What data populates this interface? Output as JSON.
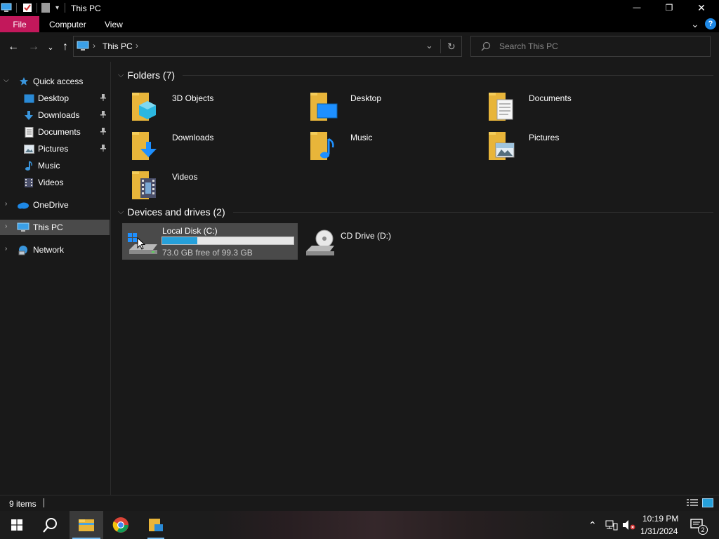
{
  "window": {
    "title": "This PC",
    "minimize_glyph": "—",
    "restore_glyph": "❐",
    "close_glyph": "✕"
  },
  "ribbon": {
    "tabs": [
      {
        "label": "File"
      },
      {
        "label": "Computer"
      },
      {
        "label": "View"
      }
    ],
    "help_glyph": "?",
    "expand_glyph": "⌄"
  },
  "nav": {
    "back_glyph": "←",
    "forward_glyph": "→",
    "recent_glyph": "⌄",
    "up_glyph": "↑",
    "address_crumb": "This PC",
    "address_sep": "›",
    "dropdown_glyph": "⌄",
    "refresh_glyph": "↻",
    "search_placeholder": "Search This PC"
  },
  "sidebar": {
    "quick_access": "Quick access",
    "items": [
      {
        "label": "Desktop",
        "icon": "desktop-icon",
        "pinned": true
      },
      {
        "label": "Downloads",
        "icon": "downloads-icon",
        "pinned": true
      },
      {
        "label": "Documents",
        "icon": "documents-icon",
        "pinned": true
      },
      {
        "label": "Pictures",
        "icon": "pictures-icon",
        "pinned": true
      },
      {
        "label": "Music",
        "icon": "music-icon",
        "pinned": false
      },
      {
        "label": "Videos",
        "icon": "videos-icon",
        "pinned": false
      }
    ],
    "onedrive": "OneDrive",
    "this_pc": "This PC",
    "network": "Network",
    "pin_glyph": "📌"
  },
  "folders": {
    "header": "Folders (7)",
    "items": [
      {
        "label": "3D Objects",
        "icon": "3d-objects-icon"
      },
      {
        "label": "Desktop",
        "icon": "desktop-icon"
      },
      {
        "label": "Documents",
        "icon": "documents-icon"
      },
      {
        "label": "Downloads",
        "icon": "downloads-icon"
      },
      {
        "label": "Music",
        "icon": "music-icon"
      },
      {
        "label": "Pictures",
        "icon": "pictures-icon"
      },
      {
        "label": "Videos",
        "icon": "videos-icon"
      }
    ]
  },
  "drives": {
    "header": "Devices and drives (2)",
    "items": [
      {
        "label": "Local Disk (C:)",
        "free_text": "73.0 GB free of 99.3 GB",
        "used_fraction": 0.265,
        "icon": "hard-drive-icon"
      },
      {
        "label": "CD Drive (D:)",
        "icon": "cd-drive-icon"
      }
    ]
  },
  "status": {
    "items_count": "9 items"
  },
  "taskbar": {
    "clock_time": "10:19 PM",
    "clock_date": "1/31/2024",
    "notification_count": "2"
  },
  "colors": {
    "accent_file_tab": "#c2185b",
    "folder_yellow": "#e8b53a",
    "progress_blue": "#26a0da",
    "selection_gray": "#4a4a4a"
  }
}
